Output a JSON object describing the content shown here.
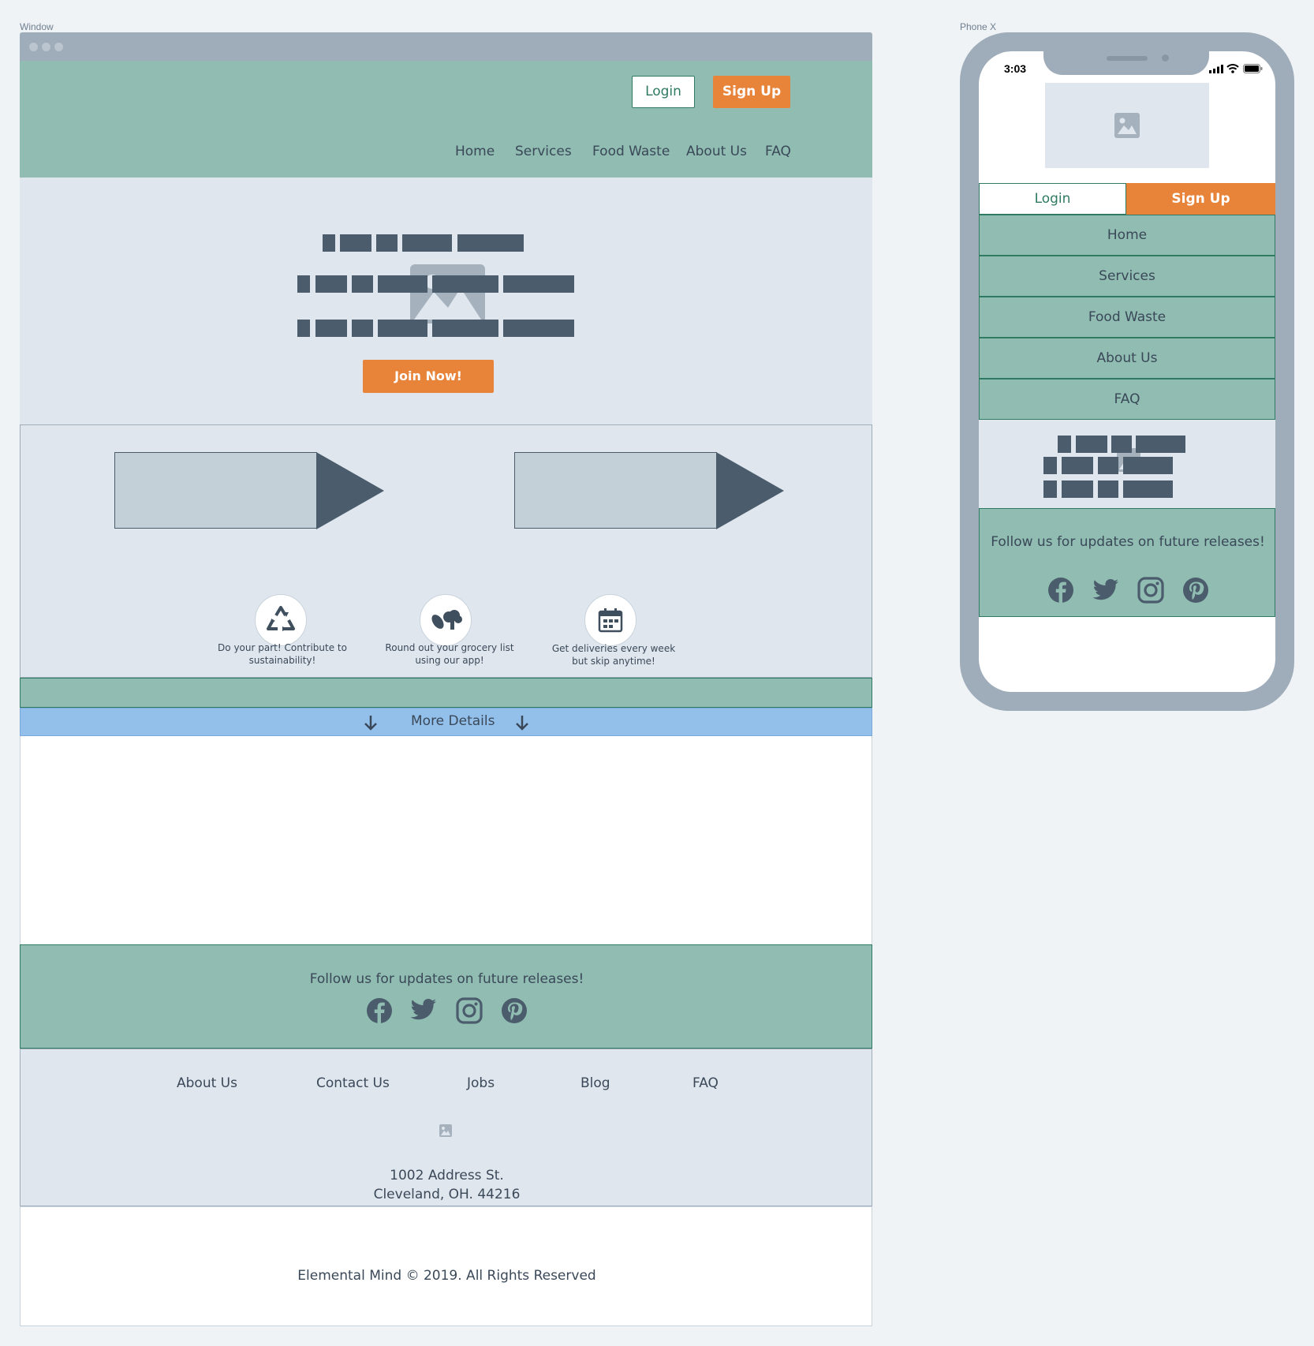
{
  "captions": {
    "window": "Window",
    "phone": "Phone X"
  },
  "header": {
    "login_label": "Login",
    "signup_label": "Sign Up",
    "nav": [
      "Home",
      "Services",
      "Food Waste",
      "About Us",
      "FAQ"
    ]
  },
  "hero": {
    "join_label": "Join Now!"
  },
  "features": [
    {
      "icon": "recycle-icon",
      "text_line1": "Do your part! Contribute to",
      "text_line2": "sustainability!"
    },
    {
      "icon": "groceries-icon",
      "text_line1": "Round out your grocery list",
      "text_line2": "using our app!"
    },
    {
      "icon": "calendar-icon",
      "text_line1": "Get deliveries every week",
      "text_line2": "but skip anytime!"
    }
  ],
  "more_details": {
    "label": "More Details"
  },
  "follow": {
    "text": "Follow us for updates on future releases!",
    "socials": [
      "facebook-icon",
      "twitter-icon",
      "instagram-icon",
      "pinterest-icon"
    ]
  },
  "footer": {
    "links": [
      "About Us",
      "Contact Us",
      "Jobs",
      "Blog",
      "FAQ"
    ],
    "address_line1": "1002 Address St.",
    "address_line2": "Cleveland, OH. 44216",
    "copyright": "Elemental Mind © 2019. All Rights Reserved"
  },
  "phone": {
    "time": "3:03",
    "login_label": "Login",
    "signup_label": "Sign Up",
    "nav": [
      "Home",
      "Services",
      "Food Waste",
      "About Us",
      "FAQ"
    ],
    "follow_text": "Follow us for updates on future releases!"
  },
  "colors": {
    "accent_orange": "#e8833a",
    "header_green": "#90bcb2",
    "border_green": "#2f7b62",
    "light_gray_blue": "#dfe6ee",
    "more_details_blue": "#93c0eb",
    "dark_slate": "#4b5d6c"
  }
}
